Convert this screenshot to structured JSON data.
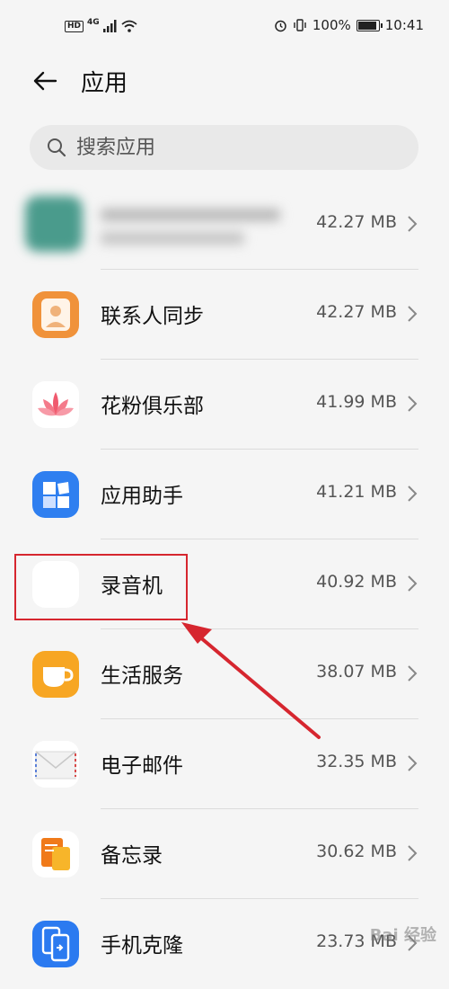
{
  "status_bar": {
    "left_badge": "HD",
    "network": "4G",
    "battery_text": "100%",
    "battery_level": 1.0,
    "time": "10:41"
  },
  "header": {
    "title": "应用",
    "back_icon": "arrow-left-icon"
  },
  "search": {
    "placeholder": "搜索应用",
    "value": "",
    "icon": "search-icon"
  },
  "apps": [
    {
      "name": "",
      "size": "42.27 MB",
      "blurred": true
    },
    {
      "name": "联系人同步",
      "size": "42.27 MB",
      "icon": "contacts-sync-icon",
      "color": "#f0923a"
    },
    {
      "name": "花粉俱乐部",
      "size": "41.99 MB",
      "icon": "lotus-icon",
      "color": "#f05a6e"
    },
    {
      "name": "应用助手",
      "size": "41.21 MB",
      "icon": "puzzle-icon",
      "color": "#2f7ff0"
    },
    {
      "name": "录音机",
      "size": "40.92 MB",
      "icon": "soundwave-icon",
      "color": "#7b5cf0"
    },
    {
      "name": "生活服务",
      "size": "38.07 MB",
      "icon": "cup-icon",
      "color": "#f7a623"
    },
    {
      "name": "电子邮件",
      "size": "32.35 MB",
      "icon": "envelope-icon",
      "color": "#e8e8e8"
    },
    {
      "name": "备忘录",
      "size": "30.62 MB",
      "icon": "memo-icon",
      "color": "#f07a1a"
    },
    {
      "name": "手机克隆",
      "size": "23.73 MB",
      "icon": "phone-clone-icon",
      "color": "#2b7af0"
    }
  ],
  "annotation": {
    "highlight_color": "#d6262f"
  }
}
